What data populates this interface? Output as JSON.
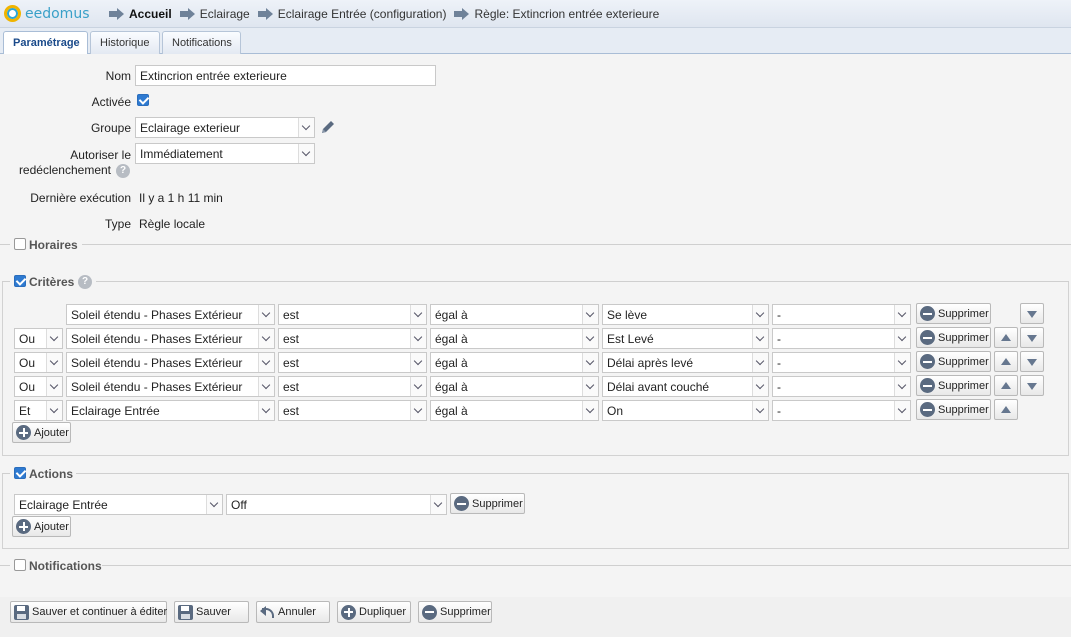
{
  "app": {
    "logo_text": "eedomus"
  },
  "breadcrumb": [
    "Accueil",
    "Eclairage",
    "Eclairage Entrée (configuration)",
    "Règle: Extincrion entrée exterieure"
  ],
  "tabs": [
    {
      "label": "Paramétrage",
      "active": true
    },
    {
      "label": "Historique",
      "active": false
    },
    {
      "label": "Notifications",
      "active": false
    }
  ],
  "form": {
    "nom_label": "Nom",
    "nom_value": "Extincrion entrée exterieure",
    "activee_label": "Activée",
    "activee_checked": true,
    "groupe_label": "Groupe",
    "groupe_value": "Eclairage exterieur",
    "autoriser_label_1": "Autoriser le",
    "autoriser_label_2": "redéclenchement",
    "autoriser_value": "Immédiatement",
    "derniere_label": "Dernière exécution",
    "derniere_value": "Il y a 1 h 11 min",
    "type_label": "Type",
    "type_value": "Règle locale",
    "help_glyph": "?"
  },
  "sections": {
    "horaires": {
      "title": "Horaires",
      "checked": false
    },
    "criteres": {
      "title": "Critères",
      "checked": true
    },
    "actions": {
      "title": "Actions",
      "checked": true
    },
    "notifications": {
      "title": "Notifications",
      "checked": false
    }
  },
  "criteria": [
    {
      "op": "",
      "device": "Soleil étendu - Phases Extérieur",
      "verb": "est",
      "cmp": "égal à",
      "value": "Se lève",
      "extra": "-",
      "remove": "Supprimer",
      "up": false,
      "down": true
    },
    {
      "op": "Ou",
      "device": "Soleil étendu - Phases Extérieur",
      "verb": "est",
      "cmp": "égal à",
      "value": "Est Levé",
      "extra": "-",
      "remove": "Supprimer",
      "up": true,
      "down": true
    },
    {
      "op": "Ou",
      "device": "Soleil étendu - Phases Extérieur",
      "verb": "est",
      "cmp": "égal à",
      "value": "Délai après levé",
      "extra": "-",
      "remove": "Supprimer",
      "up": true,
      "down": true
    },
    {
      "op": "Ou",
      "device": "Soleil étendu - Phases Extérieur",
      "verb": "est",
      "cmp": "égal à",
      "value": "Délai avant couché",
      "extra": "-",
      "remove": "Supprimer",
      "up": true,
      "down": true
    },
    {
      "op": "Et",
      "device": "Eclairage Entrée",
      "verb": "est",
      "cmp": "égal à",
      "value": "On",
      "extra": "-",
      "remove": "Supprimer",
      "up": true,
      "down": false
    }
  ],
  "criteria_add": "Ajouter",
  "actions": [
    {
      "device": "Eclairage Entrée",
      "value": "Off",
      "remove": "Supprimer"
    }
  ],
  "actions_add": "Ajouter",
  "footer": {
    "save_continue": "Sauver et continuer à éditer",
    "save": "Sauver",
    "cancel": "Annuler",
    "duplicate": "Dupliquer",
    "delete": "Supprimer"
  },
  "colors": {
    "accent": "#2e7ad1",
    "tab_active_text": "#1a4a8a",
    "icon": "#5a6a80"
  }
}
